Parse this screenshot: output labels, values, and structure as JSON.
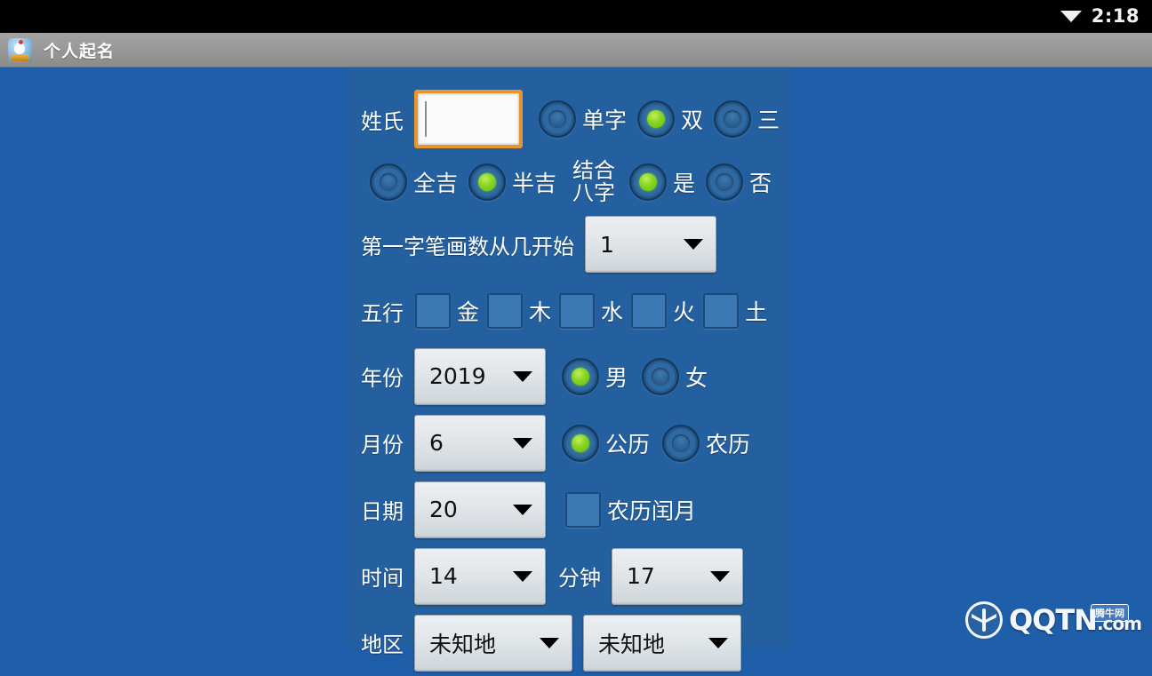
{
  "status_bar": {
    "wifi_icon": "wifi-icon",
    "time": "2:18"
  },
  "title_bar": {
    "app_icon": "app-icon",
    "title": "个人起名"
  },
  "form": {
    "surname": {
      "label": "姓氏",
      "value": "",
      "placeholder": "",
      "focused": true,
      "options": [
        {
          "label": "单字",
          "selected": false
        },
        {
          "label": "双",
          "selected": true
        },
        {
          "label": "三",
          "selected": false
        }
      ]
    },
    "luck": {
      "options": [
        {
          "label": "全吉",
          "selected": false
        },
        {
          "label": "半吉",
          "selected": true
        }
      ]
    },
    "bazi": {
      "label_line1": "结合",
      "label_line2": "八字",
      "options": [
        {
          "label": "是",
          "selected": true
        },
        {
          "label": "否",
          "selected": false
        }
      ]
    },
    "stroke_start": {
      "label": "第一字笔画数从几开始",
      "value": "1"
    },
    "wuxing": {
      "label": "五行",
      "items": [
        {
          "label": "金",
          "checked": false
        },
        {
          "label": "木",
          "checked": false
        },
        {
          "label": "水",
          "checked": false
        },
        {
          "label": "火",
          "checked": false
        },
        {
          "label": "土",
          "checked": false
        }
      ]
    },
    "year": {
      "label": "年份",
      "value": "2019",
      "gender": [
        {
          "label": "男",
          "selected": true
        },
        {
          "label": "女",
          "selected": false
        }
      ]
    },
    "month": {
      "label": "月份",
      "value": "6",
      "calendar": [
        {
          "label": "公历",
          "selected": true
        },
        {
          "label": "农历",
          "selected": false
        }
      ]
    },
    "day": {
      "label": "日期",
      "value": "20",
      "leap_month": {
        "label": "农历闰月",
        "checked": false
      }
    },
    "time": {
      "hour_label": "时间",
      "hour_value": "14",
      "minute_label": "分钟",
      "minute_value": "17"
    },
    "region": {
      "label": "地区",
      "province_value": "未知地",
      "city_value": "未知地"
    }
  },
  "watermark": {
    "brand": "QQTN",
    "domain": ".com",
    "sub": "腾牛网"
  },
  "colors": {
    "app_background": "#1f5ea8",
    "panel_background": "#24609f",
    "accent_green": "#86d422",
    "focus_orange": "#e8962c",
    "title_bar": "#9a9a9a"
  }
}
